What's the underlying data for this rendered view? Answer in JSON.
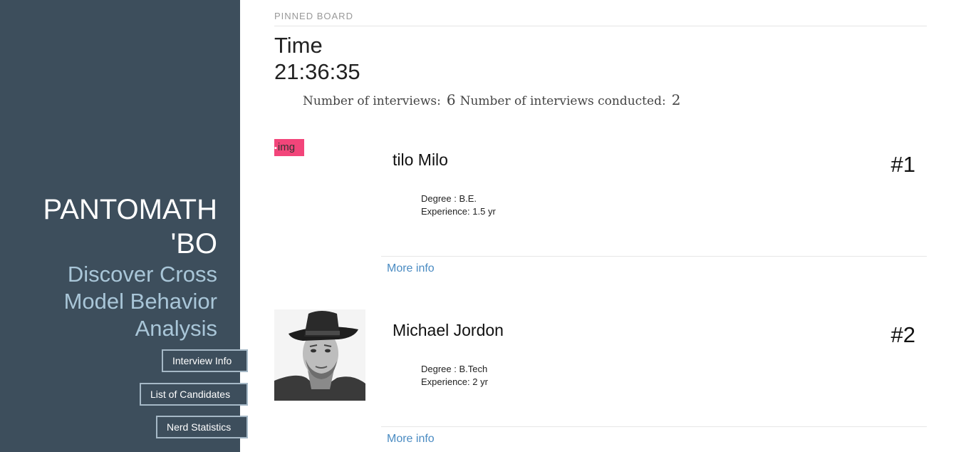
{
  "sidebar": {
    "brand_title": "PANTOMATH 'BO",
    "brand_subtitle": "Discover Cross Model Behavior Analysis",
    "buttons": [
      "Interview Info",
      "List of Candidates",
      "Nerd Statistics"
    ]
  },
  "board": {
    "pinned_label": "PINNED BOARD",
    "time_label": "Time",
    "time_value": "21:36:35",
    "interviews_label": "Number of interviews:",
    "interviews_value": "6",
    "conducted_label": "Number of interviews conducted:",
    "conducted_value": "2"
  },
  "candidates": [
    {
      "name": "tilo Milo",
      "rank": "#1",
      "degree": "Degree : B.E.",
      "experience": "Experience: 1.5 yr",
      "more": "More info",
      "img_alt": "img"
    },
    {
      "name": "Michael Jordon",
      "rank": "#2",
      "degree": "Degree : B.Tech",
      "experience": "Experience: 2 yr",
      "more": "More info"
    }
  ],
  "colors": {
    "sidebar": "#3d4e5c",
    "subtitle": "#a9c6d8",
    "link": "#4a8bc2",
    "broken_img": "#f2457a"
  }
}
